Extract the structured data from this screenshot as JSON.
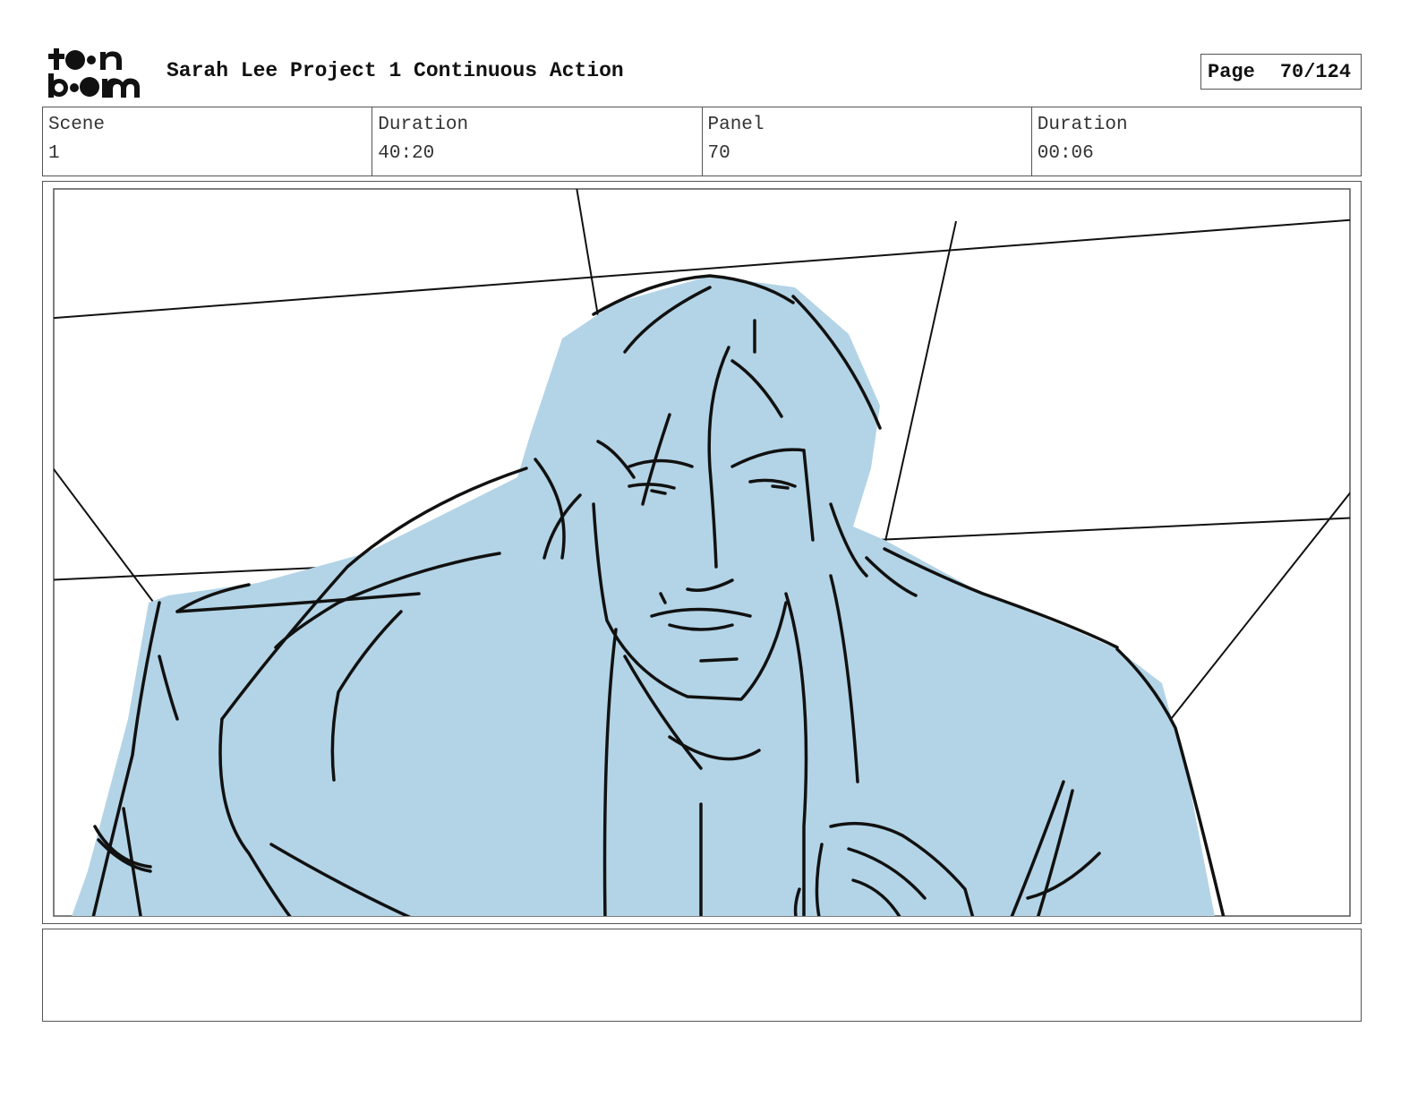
{
  "header": {
    "logo_text": "toon boom",
    "project_title": "Sarah Lee Project 1 Continuous Action",
    "page_label": "Page",
    "page_value": "70/124"
  },
  "info": {
    "scene_label": "Scene",
    "scene_value": "1",
    "scene_duration_label": "Duration",
    "scene_duration_value": "40:20",
    "panel_label": "Panel",
    "panel_value": "70",
    "panel_duration_label": "Duration",
    "panel_duration_value": "00:06"
  },
  "panel": {
    "fill_color": "#b3d4e6",
    "line_color": "#111111"
  },
  "notes": {
    "text": ""
  }
}
